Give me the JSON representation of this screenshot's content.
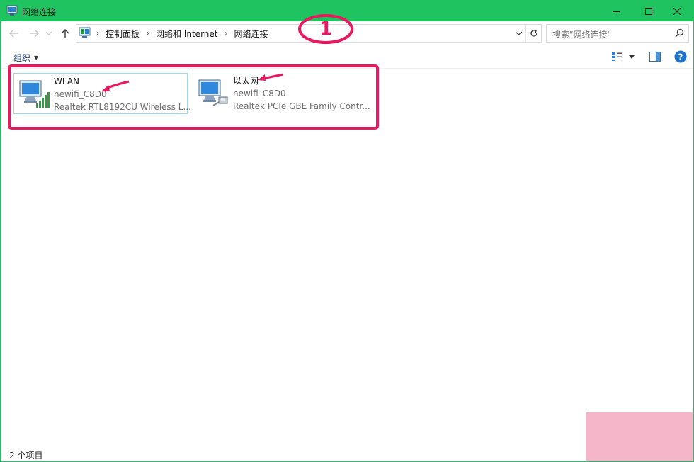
{
  "window": {
    "title": "网络连接"
  },
  "address": {
    "crumbs": [
      "控制面板",
      "网络和 Internet",
      "网络连接"
    ]
  },
  "search": {
    "placeholder": "搜索\"网络连接\""
  },
  "toolbar": {
    "organize_label": "组织"
  },
  "connections": [
    {
      "name": "WLAN",
      "network": "newifi_C8D0",
      "adapter": "Realtek RTL8192CU Wireless L...",
      "icon": "wireless-network-icon"
    },
    {
      "name": "以太网",
      "network": "newifi_C8D0",
      "adapter": "Realtek PCIe GBE Family Contr...",
      "icon": "ethernet-network-icon"
    }
  ],
  "annotation": {
    "number": "1",
    "color": "#e8195e"
  },
  "status": {
    "item_count": "2 个项目"
  },
  "colors": {
    "titlebar": "#1fc460",
    "selection": "#9fd4ef",
    "annotation": "#e8195e"
  }
}
